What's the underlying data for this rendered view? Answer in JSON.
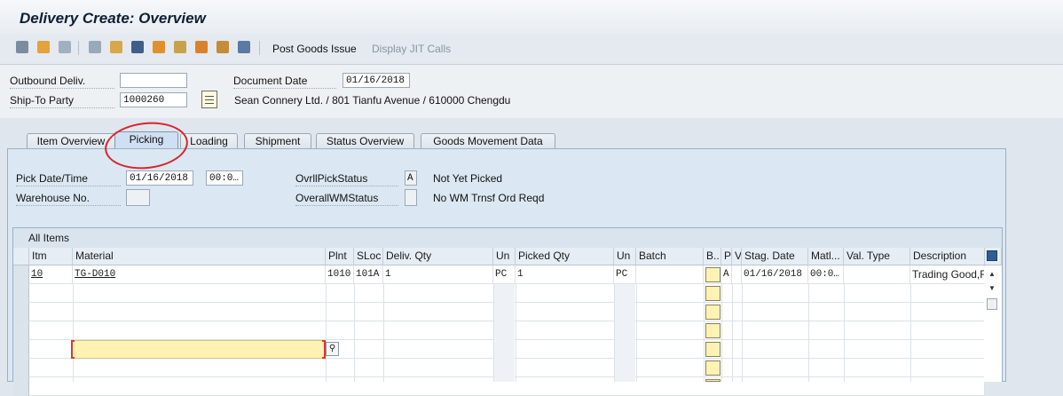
{
  "window": {
    "title": "Delivery  Create: Overview"
  },
  "toolbar": {
    "icons": [
      "display-change-icon",
      "create-icon",
      "delete-icon",
      "copy-icon",
      "partner-icon",
      "texts-icon",
      "dates-icon",
      "batch-icon",
      "warehouse-icon",
      "more-icon"
    ],
    "post_goods_issue": "Post Goods Issue",
    "display_jit_calls": "Display JIT Calls"
  },
  "header": {
    "outbound_deliv_label": "Outbound Deliv.",
    "outbound_deliv_value": "",
    "ship_to_party_label": "Ship-To Party",
    "ship_to_party_value": "1000260",
    "document_date_label": "Document Date",
    "document_date_value": "01/16/2018",
    "ship_to_address": "Sean Connery Ltd. / 801 Tianfu Avenue / 610000 Chengdu"
  },
  "tabs": [
    {
      "label": "Item Overview",
      "active": false
    },
    {
      "label": "Picking",
      "active": true
    },
    {
      "label": "Loading",
      "active": false
    },
    {
      "label": "Shipment",
      "active": false
    },
    {
      "label": "Status Overview",
      "active": false
    },
    {
      "label": "Goods Movement Data",
      "active": false
    }
  ],
  "picking": {
    "pick_date_label": "Pick Date/Time",
    "pick_date_value": "01/16/2018",
    "pick_time_value": "00:0…",
    "warehouse_label": "Warehouse No.",
    "warehouse_value": "",
    "ovrl_pick_status_label": "OvrllPickStatus",
    "ovrl_pick_status_code": "A",
    "ovrl_pick_status_text": "Not Yet Picked",
    "overall_wm_status_label": "OverallWMStatus",
    "overall_wm_status_code": "",
    "overall_wm_status_text": "No WM Trnsf Ord Reqd"
  },
  "table": {
    "title": "All Items",
    "columns": [
      "Itm",
      "Material",
      "Plnt",
      "SLoc",
      "Deliv. Qty",
      "Un",
      "Picked Qty",
      "Un",
      "Batch",
      "B..",
      "P",
      "V",
      "Stag. Date",
      "Matl...",
      "Val. Type",
      "Description"
    ],
    "rows": [
      {
        "itm": "10",
        "material": "TG-D010",
        "plnt": "1010",
        "sloc": "101A",
        "deliv_qty": "1",
        "un": "PC",
        "picked_qty": "1",
        "un2": "PC",
        "batch": "",
        "p": "A",
        "v": "",
        "stag_date": "01/16/2018",
        "matl": "00:0…",
        "val_type": "",
        "description": "Trading Good,F"
      }
    ]
  },
  "colors": {
    "annotation_red": "#d8242c",
    "input_highlight": "#fff2b3",
    "panel_blue": "#dbe8f3"
  }
}
